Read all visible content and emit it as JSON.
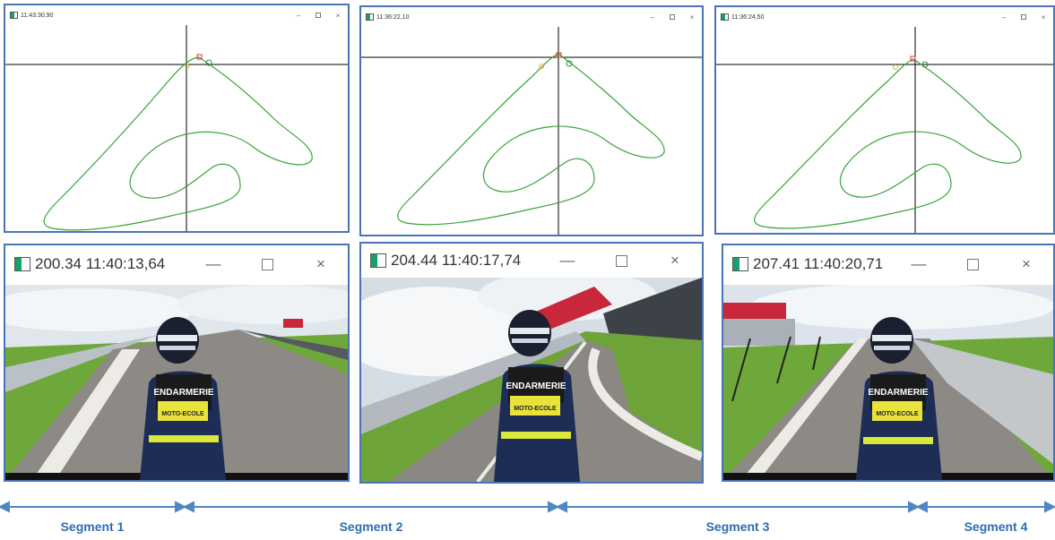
{
  "track_windows": [
    {
      "title": "11:43:30,90",
      "minimize_glyph": "–",
      "close_glyph": "×"
    },
    {
      "title": "11:36:22,10",
      "minimize_glyph": "–",
      "close_glyph": "×"
    },
    {
      "title": "11:36:24,50",
      "minimize_glyph": "–",
      "close_glyph": "×"
    }
  ],
  "video_windows": [
    {
      "title": "200.34 11:40:13,64",
      "minimize_glyph": "—",
      "close_glyph": "×",
      "vest_text": "ENDARMERIE",
      "badge_text": "MOTO-ECOLE"
    },
    {
      "title": "204.44 11:40:17,74",
      "minimize_glyph": "—",
      "close_glyph": "×",
      "vest_text": "ENDARMERIE",
      "badge_text": "MOTO-ECOLE"
    },
    {
      "title": "207.41 11:40:20,71",
      "minimize_glyph": "—",
      "close_glyph": "×",
      "vest_text": "ENDARMERIE",
      "badge_text": "MOTO-ECOLE"
    }
  ],
  "segments": [
    {
      "label": "Segment 1"
    },
    {
      "label": "Segment 2"
    },
    {
      "label": "Segment 3"
    },
    {
      "label": "Segment 4"
    }
  ],
  "colors": {
    "panel_border": "#4a73b8",
    "track_line": "#3aa33a",
    "crosshair": "#000000",
    "marker_red": "#e03030",
    "marker_green": "#2e8b2e",
    "marker_yellow": "#d9b32b",
    "segment_arrow": "#4f86c6",
    "segment_text": "#2d6db2"
  },
  "icons": {
    "window_icon": "window-app-icon",
    "minimize": "minimize-icon",
    "maximize": "maximize-icon",
    "close": "close-icon"
  }
}
